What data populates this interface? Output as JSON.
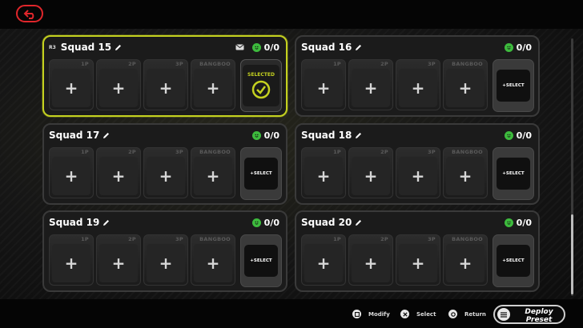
{
  "header": {
    "back_icon": "return-arrow-icon",
    "accent": "#e0262b"
  },
  "colors": {
    "active_border": "#c4d120",
    "smile": "#3dbb3d"
  },
  "squads": [
    {
      "r3": "R3",
      "title": "Squad 15",
      "count": "0/0",
      "slots": [
        "1P",
        "2P",
        "3P",
        "BANGBOO"
      ],
      "plus": "+",
      "selected_label": "SELECTED"
    },
    {
      "title": "Squad 16",
      "count": "0/0",
      "slots": [
        "1P",
        "2P",
        "3P",
        "BANGBOO"
      ],
      "plus": "+",
      "select_label": "+SELECT"
    },
    {
      "title": "Squad 17",
      "count": "0/0",
      "slots": [
        "1P",
        "2P",
        "3P",
        "BANGBOO"
      ],
      "plus": "+",
      "select_label": "+SELECT"
    },
    {
      "title": "Squad 18",
      "count": "0/0",
      "slots": [
        "1P",
        "2P",
        "3P",
        "BANGBOO"
      ],
      "plus": "+",
      "select_label": "+SELECT"
    },
    {
      "title": "Squad 19",
      "count": "0/0",
      "slots": [
        "1P",
        "2P",
        "3P",
        "BANGBOO"
      ],
      "plus": "+",
      "select_label": "+SELECT"
    },
    {
      "title": "Squad 20",
      "count": "0/0",
      "slots": [
        "1P",
        "2P",
        "3P",
        "BANGBOO"
      ],
      "plus": "+",
      "select_label": "+SELECT"
    }
  ],
  "footer": {
    "modify": "Modify",
    "select": "Select",
    "return": "Return",
    "deploy": "Deploy Preset"
  }
}
